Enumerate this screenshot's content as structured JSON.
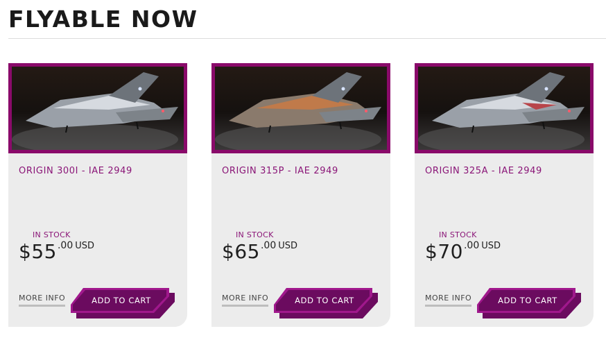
{
  "section": {
    "title": "FLYABLE NOW"
  },
  "colors": {
    "accent": "#8a1577",
    "button_dark": "#6b0b5f",
    "button_light": "#a0188c",
    "card_bg": "#ececec"
  },
  "products": [
    {
      "name": "ORIGIN 300I - IAE 2949",
      "stock": "IN STOCK",
      "currency": "$",
      "amount": "55",
      "cents": ".00",
      "currency_code": "USD",
      "more_info": "MORE INFO",
      "add_to_cart": "ADD TO CART",
      "image_icon": "spaceship-image"
    },
    {
      "name": "ORIGIN 315P - IAE 2949",
      "stock": "IN STOCK",
      "currency": "$",
      "amount": "65",
      "cents": ".00",
      "currency_code": "USD",
      "more_info": "MORE INFO",
      "add_to_cart": "ADD TO CART",
      "image_icon": "spaceship-image"
    },
    {
      "name": "ORIGIN 325A - IAE 2949",
      "stock": "IN STOCK",
      "currency": "$",
      "amount": "70",
      "cents": ".00",
      "currency_code": "USD",
      "more_info": "MORE INFO",
      "add_to_cart": "ADD TO CART",
      "image_icon": "spaceship-image"
    }
  ]
}
